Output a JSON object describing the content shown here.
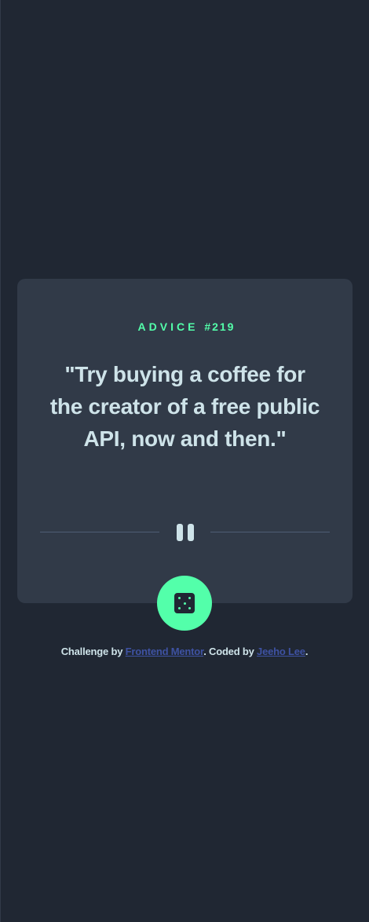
{
  "advice": {
    "label": "ADVICE",
    "number": "#219",
    "quote": "\"Try buying a coffee for the creator of a free public API, now and then.\""
  },
  "icons": {
    "divider": "pause-icon",
    "button": "dice-icon"
  },
  "attribution": {
    "prefix": "Challenge by ",
    "challenge_link": "Frontend Mentor",
    "middle": ". Coded by ",
    "author_link": "Jeeho Lee",
    "suffix": "."
  },
  "colors": {
    "background": "#202733",
    "card": "#313a48",
    "accent": "#53ffaa",
    "text": "#cee3e9",
    "divider": "#4f5d74",
    "link": "#3e52a3"
  }
}
